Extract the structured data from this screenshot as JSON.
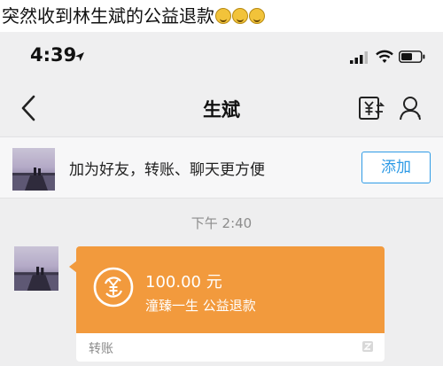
{
  "caption": {
    "text": "突然收到林生斌的公益退款",
    "emoji_icon": "grimacing-face-emoji",
    "emoji_count": 3
  },
  "status_bar": {
    "time": "4:39"
  },
  "navbar": {
    "title": "生斌"
  },
  "friend_bar": {
    "text": "加为好友，转账、聊天更方便",
    "add_button": "添加"
  },
  "timestamp": "下午 2:40",
  "transfer_message": {
    "amount": "100.00 元",
    "remark": "潼臻一生 公益退款",
    "type_label": "转账",
    "color": "#f29a3d"
  },
  "colors": {
    "accent": "#2f9be6",
    "transfer": "#f29a3d",
    "background": "#eeeeef"
  }
}
